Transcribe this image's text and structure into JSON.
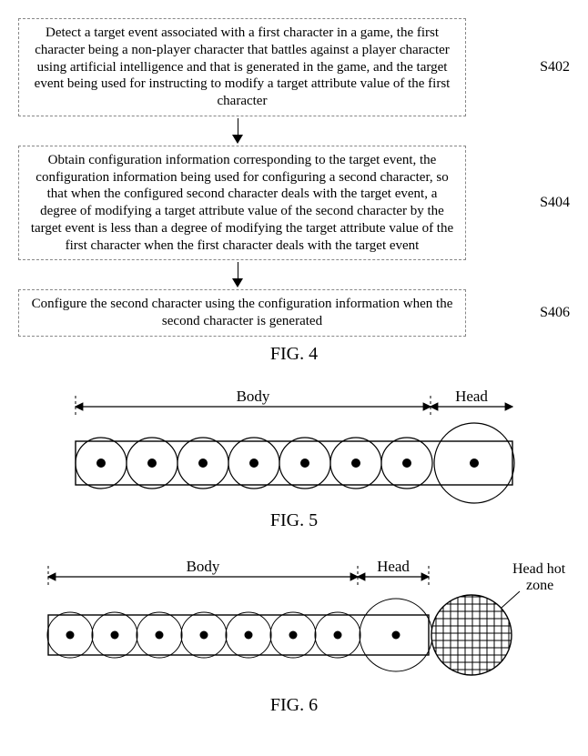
{
  "flowchart": {
    "steps": [
      {
        "id": "S402",
        "text": "Detect a target event associated with a first character in a game, the first character being a non-player character that battles against a player character using artificial intelligence and that is generated in the game, and the target event being used for instructing to modify a target attribute value of the first character"
      },
      {
        "id": "S404",
        "text": "Obtain configuration information corresponding to the target event, the configuration information being used for configuring a second character, so that when the configured second character deals with the target event, a degree of modifying a target attribute value of the second character by the target event is less than a degree of modifying the target attribute value of the first character when the first character deals with the target event"
      },
      {
        "id": "S406",
        "text": "Configure the second character using the configuration information when the second character is generated"
      }
    ]
  },
  "fig4_caption": "FIG. 4",
  "fig5": {
    "body_label": "Body",
    "head_label": "Head",
    "caption": "FIG. 5"
  },
  "fig6": {
    "body_label": "Body",
    "head_label": "Head",
    "hotzone_label": "Head hot\nzone",
    "caption": "FIG. 6"
  },
  "chart_data": [
    {
      "type": "diagram",
      "name": "flowchart-fig4",
      "steps": [
        "S402",
        "S404",
        "S406"
      ],
      "edges": [
        [
          "S402",
          "S404"
        ],
        [
          "S404",
          "S406"
        ]
      ]
    },
    {
      "type": "diagram",
      "name": "segment-fig5",
      "body_segments": 7,
      "head_segments": 1,
      "head_hot_zone": false
    },
    {
      "type": "diagram",
      "name": "segment-fig6",
      "body_segments": 7,
      "head_segments": 1,
      "head_hot_zone": true
    }
  ]
}
